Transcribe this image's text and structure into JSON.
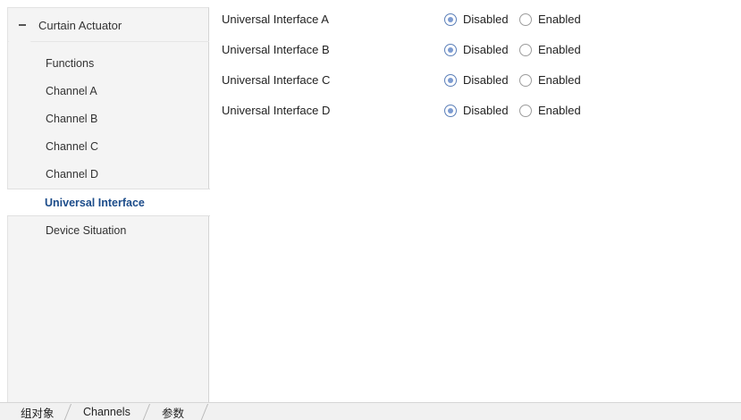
{
  "sidebar": {
    "root_label": "Curtain Actuator",
    "items": [
      {
        "label": "Functions"
      },
      {
        "label": "Channel A"
      },
      {
        "label": "Channel B"
      },
      {
        "label": "Channel C"
      },
      {
        "label": "Channel D"
      },
      {
        "label": "Universal Interface"
      },
      {
        "label": "Device Situation"
      }
    ],
    "active_index": 5
  },
  "main": {
    "option_disabled": "Disabled",
    "option_enabled": "Enabled",
    "params": [
      {
        "label": "Universal Interface A",
        "selected": "Disabled"
      },
      {
        "label": "Universal Interface B",
        "selected": "Disabled"
      },
      {
        "label": "Universal Interface C",
        "selected": "Disabled"
      },
      {
        "label": "Universal Interface D",
        "selected": "Disabled"
      }
    ]
  },
  "tabs": [
    {
      "label": "组对象"
    },
    {
      "label": "Channels"
    },
    {
      "label": "参数"
    }
  ],
  "colors": {
    "active_nav_text": "#1c4c8a",
    "radio_checked": "#7c9bd1"
  }
}
